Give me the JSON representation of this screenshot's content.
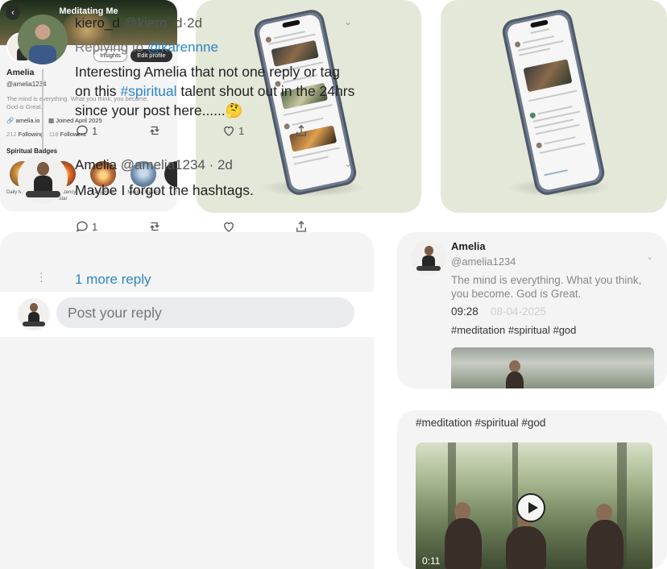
{
  "profile": {
    "header_title": "Meditating Me",
    "back_icon": "chevron-left-icon",
    "insights_label": "Insights",
    "edit_profile_label": "Edit profile",
    "name": "Amelia",
    "handle": "@amelia1234",
    "bio": "The mind is everything. What you think, you become. God is Great.",
    "link": "amelia.io",
    "joined": "Joined April 2025",
    "following_count": "212",
    "following_label": "Following",
    "followers_count": "118",
    "followers_label": "Followers",
    "badges_title": "Spiritual Badges",
    "badges": [
      {
        "label": "Daily Meditator",
        "color": "#c98a3a"
      },
      {
        "label": "Consistency Star",
        "color": "#d0582a"
      },
      {
        "label": "Early Riser",
        "color": "#c0703a"
      },
      {
        "label": "Mindful Master",
        "color": "#6f8fae"
      },
      {
        "label": "S",
        "color": "#2a2a2a"
      }
    ]
  },
  "thread": {
    "first_tweet": {
      "name": "kiero_d",
      "handle": "@kiero_d",
      "time": "·2d",
      "replying_label": "Replying to ",
      "replying_to": "@karennne",
      "text_before": "Interesting Amelia that not one reply or tag on this ",
      "hashtag": "#spiritual",
      "text_after": " talent shout out in the 24hrs since your post here......🤔",
      "reply_count": "1",
      "like_count": "1"
    },
    "second_tweet": {
      "name": "Amelia",
      "handle": "@amelia1234",
      "time": "· 2d",
      "text": "Maybe I forgot the hashtags.",
      "reply_count": "1"
    },
    "more_replies": "1 more reply",
    "reply_placeholder": "Post your reply"
  },
  "post": {
    "name": "Amelia",
    "handle": "@amelia1234",
    "text": "The mind is everything. What you think, you become. God is Great.",
    "time": "09:28",
    "date": "08-04-2025",
    "tags": "#meditation #spiritual #god"
  },
  "video": {
    "tags": "#meditation #spiritual #god",
    "duration": "0:11"
  },
  "colors": {
    "accent": "#2b86c5",
    "card_bg": "#f4f4f4",
    "mock_bg": "#e4e8d8"
  }
}
